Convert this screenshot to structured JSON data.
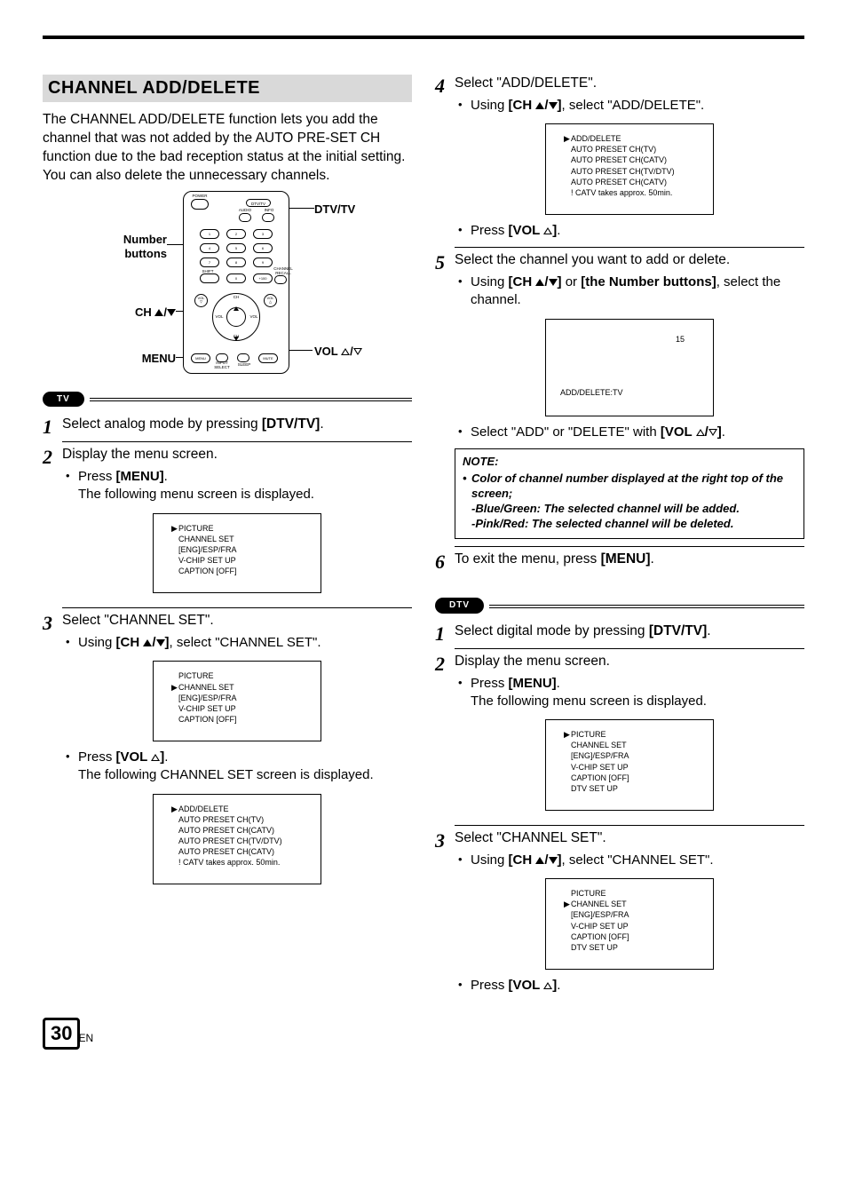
{
  "page": {
    "number": "30",
    "lang": "EN"
  },
  "title": "CHANNEL ADD/DELETE",
  "intro": "The CHANNEL ADD/DELETE function lets you add the channel that was not added by the AUTO PRE-SET CH function due to the bad reception status at the initial setting. You can also delete the unnecessary channels.",
  "remote": {
    "labels": {
      "dtvtv": "DTV/TV",
      "number_buttons_l1": "Number",
      "number_buttons_l2": "buttons",
      "ch": "CH ",
      "menu": "MENU",
      "vol": "VOL "
    },
    "tiny": {
      "power": "POWER",
      "dtvtv": "DTV/TV",
      "audio": "AUDIO",
      "info": "INFO",
      "k1": "1",
      "k2": "2",
      "k3": "3",
      "k4": "4",
      "k5": "5",
      "k6": "6",
      "k7": "7",
      "k8": "8",
      "k9": "9",
      "k0": "0",
      "shift": "SHIFT",
      "plus100": "+100",
      "chrecall": "CHANNEL RECALL",
      "vol": "VOL",
      "ch": "CH",
      "menu": "MENU",
      "input": "INPUT SELECT",
      "sleep": "SLEEP",
      "mute": "MUTE"
    }
  },
  "tags": {
    "tv": "TV",
    "dtv": "DTV"
  },
  "tv": {
    "s1": "Select analog mode by pressing ",
    "s1b": "[DTV/TV]",
    "s2": "Display the menu screen.",
    "s2a_pre": "Press ",
    "s2a_b": "[MENU]",
    "s2a_post": ".",
    "s2b": "The following menu screen is displayed.",
    "menu1": [
      "PICTURE",
      "CHANNEL SET",
      "[ENG]/ESP/FRA",
      "V-CHIP SET UP",
      "CAPTION [OFF]"
    ],
    "menu1_cursor_index": 0,
    "s3": "Select \"CHANNEL SET\".",
    "s3a_pre": "Using ",
    "s3a_b": "[CH ▲/▼]",
    "s3a_post": ", select \"CHANNEL SET\".",
    "menu2_cursor_index": 1,
    "s3b_pre": "Press ",
    "s3b_b": "[VOL △]",
    "s3b_post": ".",
    "s3c": "The following CHANNEL SET screen is displayed.",
    "menu3": [
      "ADD/DELETE",
      "AUTO PRESET CH(TV)",
      "AUTO PRESET CH(CATV)",
      "AUTO PRESET CH(TV/DTV)",
      "AUTO PRESET CH(CATV)",
      "! CATV takes approx. 50min."
    ],
    "menu3_cursor_index": 0
  },
  "right": {
    "s4": "Select \"ADD/DELETE\".",
    "s4a_pre": "Using ",
    "s4a_b": "[CH ▲/▼]",
    "s4a_post": ", select \"ADD/DELETE\".",
    "menu4": [
      "ADD/DELETE",
      "AUTO PRESET CH(TV)",
      "AUTO PRESET CH(CATV)",
      "AUTO PRESET CH(TV/DTV)",
      "AUTO PRESET CH(CATV)",
      "! CATV takes approx. 50min."
    ],
    "menu4_cursor_index": 0,
    "s4b_pre": "Press ",
    "s4b_b": "[VOL △]",
    "s4b_post": ".",
    "s5": "Select the channel you want to add or delete.",
    "s5a_pre": "Using ",
    "s5a_b1": "[CH ▲/▼]",
    "s5a_mid": " or ",
    "s5a_b2": "[the Number buttons]",
    "s5a_post": ", select the channel.",
    "ch15": {
      "num": "15",
      "label": "ADD/DELETE:TV"
    },
    "s5b_pre": "Select \"ADD\" or \"DELETE\" with ",
    "s5b_b": "[VOL △/▽]",
    "s5b_post": ".",
    "note": {
      "title": "NOTE:",
      "l1": "Color of channel number displayed at the right top of the screen;",
      "l2": "-Blue/Green: The selected channel will be added.",
      "l3": "-Pink/Red: The selected channel will be deleted."
    },
    "s6_pre": "To exit the menu, press ",
    "s6_b": "[MENU]",
    "s6_post": "."
  },
  "dtv": {
    "s1": "Select digital mode by pressing ",
    "s1b": "[DTV/TV]",
    "s2": "Display the menu screen.",
    "s2a_pre": "Press ",
    "s2a_b": "[MENU]",
    "s2a_post": ".",
    "s2b": "The following menu screen is displayed.",
    "menu1": [
      "PICTURE",
      "CHANNEL SET",
      "[ENG]/ESP/FRA",
      "V-CHIP SET UP",
      "CAPTION [OFF]",
      "DTV SET UP"
    ],
    "menu1_cursor_index": 0,
    "s3": "Select \"CHANNEL SET\".",
    "s3a_pre": "Using ",
    "s3a_b": "[CH ▲/▼]",
    "s3a_post": ", select \"CHANNEL SET\".",
    "menu2_cursor_index": 1,
    "s3b_pre": "Press ",
    "s3b_b": "[VOL △]",
    "s3b_post": "."
  }
}
